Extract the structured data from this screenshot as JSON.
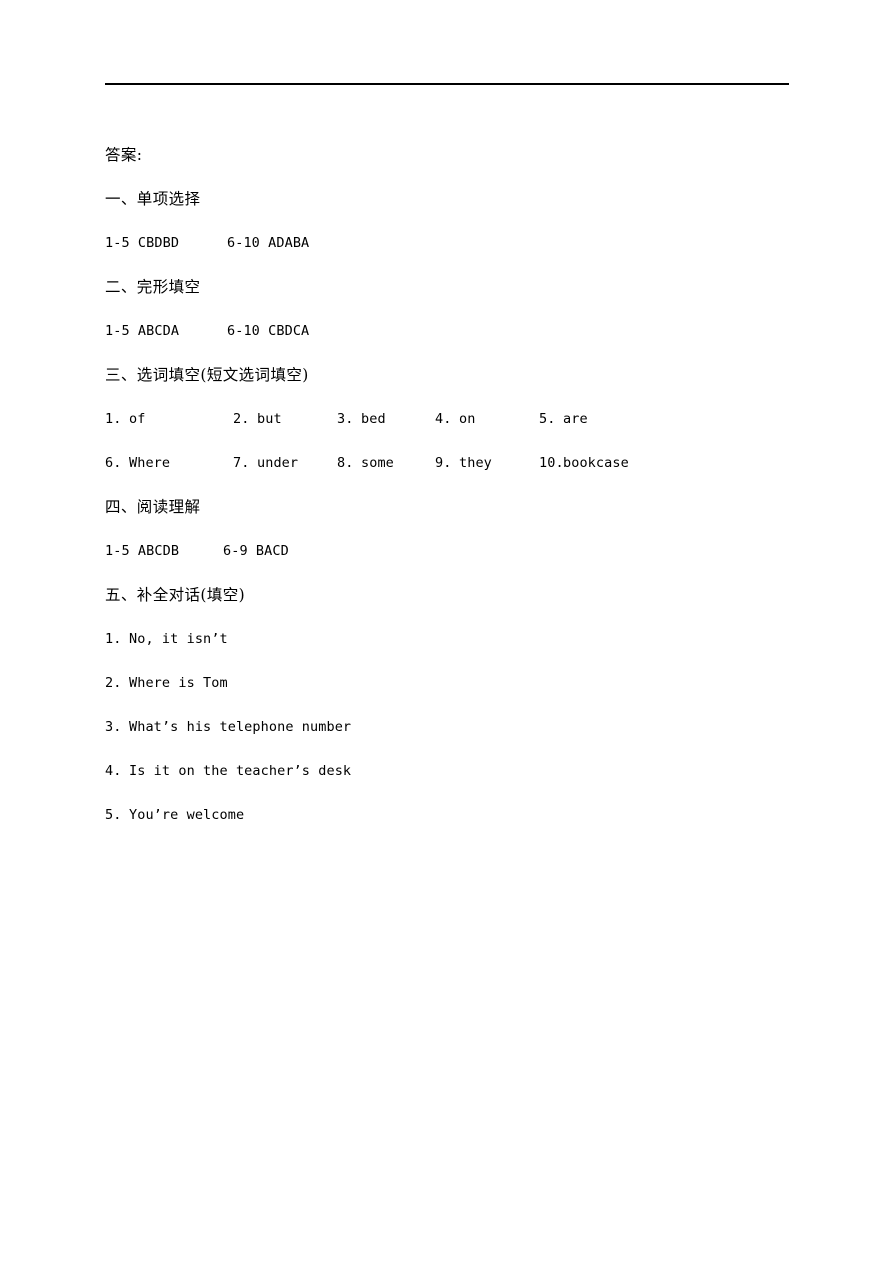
{
  "document": {
    "title_label": "答案:",
    "sections": [
      {
        "heading": "一、单项选择",
        "answer_left": "1-5 CBDBD",
        "answer_right": "6-10 ADABA"
      },
      {
        "heading": "二、完形填空",
        "answer_left": "1-5 ABCDA",
        "answer_right": "6-10 CBDCA"
      },
      {
        "heading": "三、选词填空(短文选词填空)",
        "words_row1": [
          {
            "num": "1.",
            "word": "of"
          },
          {
            "num": "2.",
            "word": "but"
          },
          {
            "num": "3.",
            "word": "bed"
          },
          {
            "num": "4.",
            "word": "on"
          },
          {
            "num": "5.",
            "word": "are"
          }
        ],
        "words_row2": [
          {
            "num": "6.",
            "word": "Where"
          },
          {
            "num": "7.",
            "word": "under"
          },
          {
            "num": "8.",
            "word": "some"
          },
          {
            "num": "9.",
            "word": "they"
          },
          {
            "num": "10.",
            "word": "bookcase"
          }
        ]
      },
      {
        "heading": "四、阅读理解",
        "answer_left": "1-5 ABCDB",
        "answer_right": "6-9 BACD"
      },
      {
        "heading": "五、补全对话(填空)",
        "dialogue": [
          {
            "num": "1.",
            "text": "No, it isn’t"
          },
          {
            "num": "2.",
            "text": "Where is Tom"
          },
          {
            "num": "3.",
            "text": "What’s his telephone number"
          },
          {
            "num": "4.",
            "text": "Is it on the teacher’s desk"
          },
          {
            "num": "5.",
            "text": "You’re welcome"
          }
        ]
      }
    ]
  },
  "style": {
    "text_color": "#000000",
    "page_background": "#ffffff",
    "rule_color": "#000000"
  }
}
